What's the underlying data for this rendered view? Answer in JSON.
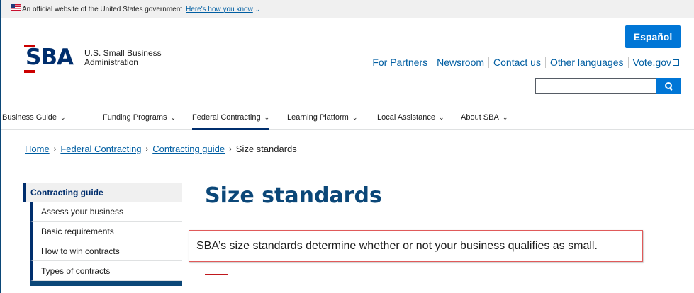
{
  "gov_banner": {
    "text": "An official website of the United States government",
    "link": "Here's how you know",
    "chevron": "⌄"
  },
  "header": {
    "logo_mark": "SBA",
    "logo_line1": "U.S. Small Business",
    "logo_line2": "Administration",
    "espanol_label": "Español",
    "util_links": [
      "For Partners",
      "Newsroom",
      "Contact us",
      "Other languages",
      "Vote.gov"
    ],
    "search_placeholder": ""
  },
  "nav": {
    "items": [
      {
        "label": "Business Guide",
        "caret": "⌄"
      },
      {
        "label": "Funding Programs",
        "caret": "⌄"
      },
      {
        "label": "Federal Contracting",
        "caret": "⌄",
        "active": true
      },
      {
        "label": "Learning Platform",
        "caret": "⌄"
      },
      {
        "label": "Local Assistance",
        "caret": "⌄"
      },
      {
        "label": "About SBA",
        "caret": "⌄"
      }
    ]
  },
  "breadcrumb": {
    "items": [
      "Home",
      "Federal Contracting",
      "Contracting guide"
    ],
    "separator": "›",
    "current": "Size standards"
  },
  "sidebar": {
    "heading": "Contracting guide",
    "items": [
      "Assess your business",
      "Basic requirements",
      "How to win contracts",
      "Types of contracts"
    ]
  },
  "main": {
    "title": "Size standards",
    "lead": "SBA’s size standards determine whether or not your business qualifies as small."
  },
  "colors": {
    "brand_navy": "#0b4778",
    "accent_blue": "#0076d6",
    "link": "#005ea2",
    "sba_red": "#cc0000"
  }
}
